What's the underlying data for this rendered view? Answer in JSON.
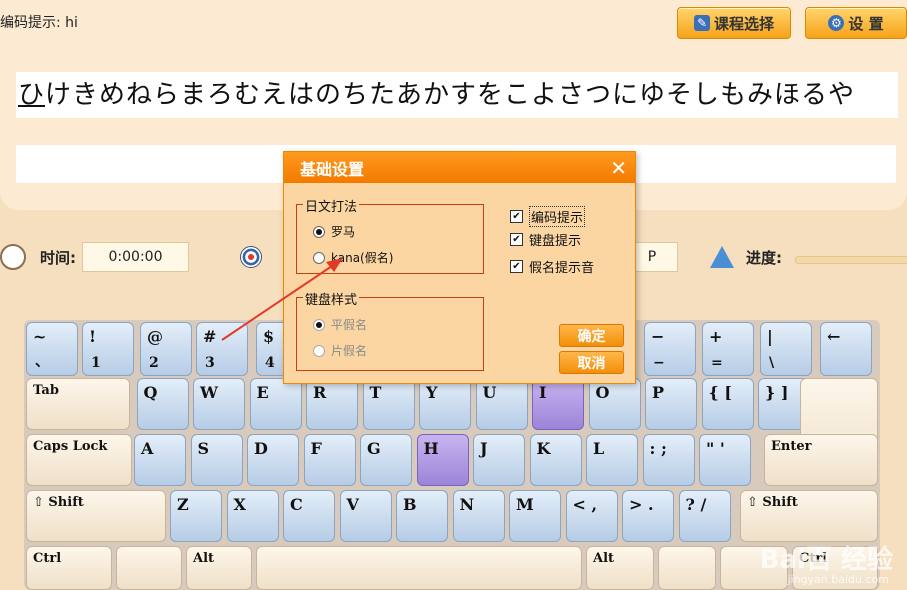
{
  "header": {
    "hint_label": "编码提示:",
    "hint_value": "hi"
  },
  "buttons": {
    "course": "课程选择",
    "settings": "设 置"
  },
  "practice": {
    "current_char": "ひ",
    "rest": "けきめねらまろむえはのちたあかすをこよさつにゆそしもみほるや"
  },
  "stats": {
    "time_label": "时间:",
    "time_value": "0:00:00",
    "partial_value": "P",
    "progress_label": "进度:",
    "progress_fraction": 0
  },
  "dialog": {
    "title": "基础设置",
    "close": "✕",
    "input_method": {
      "legend": "日文打法",
      "opt1": "罗马",
      "opt2": "kana(假名)"
    },
    "keyboard_style": {
      "legend": "键盘样式",
      "opt1": "平假名",
      "opt2": "片假名"
    },
    "checks": {
      "c1": "编码提示",
      "c2": "键盘提示",
      "c3": "假名提示音"
    },
    "ok": "确定",
    "cancel": "取消"
  },
  "keyboard": {
    "row0": [
      {
        "u": "~",
        "l": "、"
      },
      {
        "u": "!",
        "l": "1"
      },
      {
        "u": "@",
        "l": "2"
      },
      {
        "u": "#",
        "l": "3"
      },
      {
        "u": "$",
        "l": "4"
      },
      {
        "u": "−",
        "l": "−"
      },
      {
        "u": "+",
        "l": "="
      },
      {
        "u": "|",
        "l": "\\"
      },
      {
        "u": "←",
        "l": ""
      }
    ],
    "row1": [
      "Tab",
      "Q",
      "W",
      "E",
      "R",
      "T",
      "Y",
      "U",
      "I",
      "O",
      "P",
      "{ [",
      "} ]"
    ],
    "row2": [
      "Caps Lock",
      "A",
      "S",
      "D",
      "F",
      "G",
      "H",
      "J",
      "K",
      "L",
      ": ;",
      "\" '",
      "Enter"
    ],
    "row3": [
      "⇧ Shift",
      "Z",
      "X",
      "C",
      "V",
      "B",
      "N",
      "M",
      "< ,",
      "> .",
      "? /",
      "⇧ Shift"
    ],
    "row4": [
      "Ctrl",
      "",
      "Alt",
      "",
      "Alt",
      "",
      "",
      "Ctrl"
    ]
  },
  "watermark": {
    "brand": "Bai百 经验",
    "url": "jingyan.baidu.com"
  }
}
